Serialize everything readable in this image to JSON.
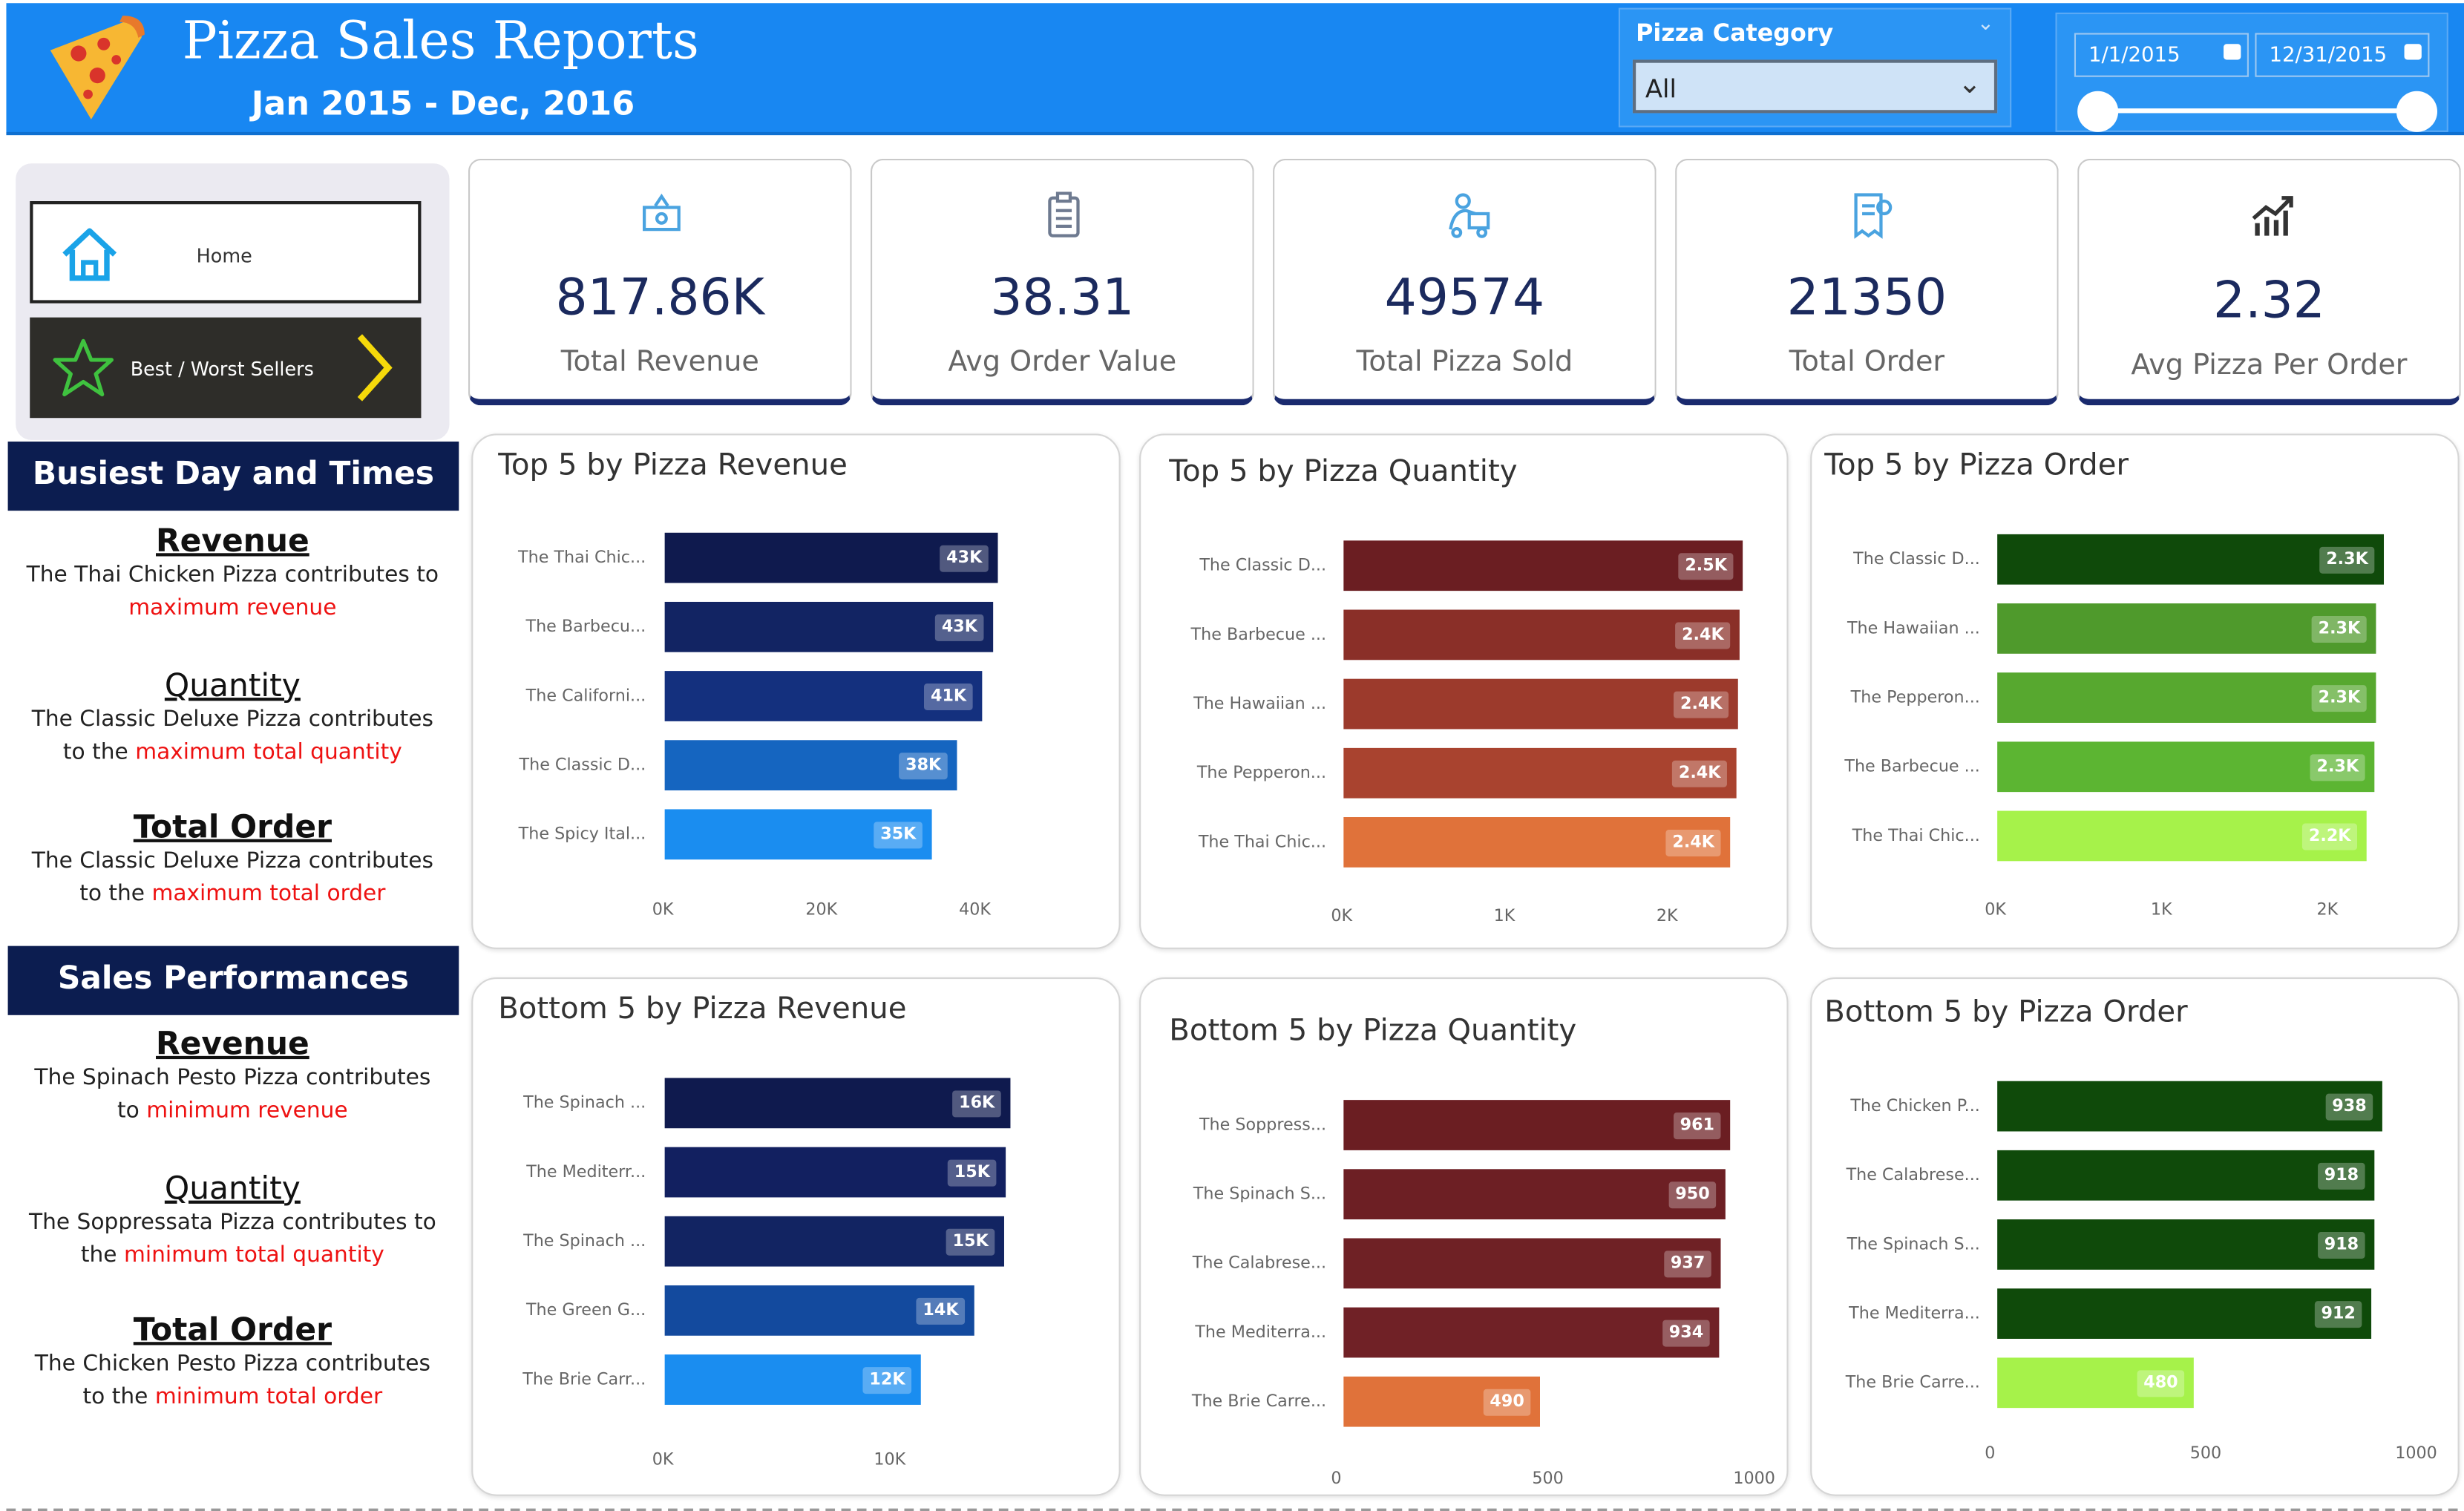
{
  "header": {
    "title": "Pizza Sales Reports",
    "subtitle": "Jan 2015 - Dec, 2016",
    "color": "#1887f2"
  },
  "filters": {
    "category_label": "Pizza Category",
    "category_value": "All",
    "date_start": "1/1/2015",
    "date_end": "12/31/2015"
  },
  "nav": {
    "home_label": "Home",
    "best_worst_label": "Best / Worst Sellers"
  },
  "busiest": {
    "header": "Busiest Day and Times",
    "items": [
      {
        "title": "Revenue",
        "text": "The Thai Chicken Pizza contributes to",
        "highlight": "maximum revenue",
        "tail": ""
      },
      {
        "title": "Quantity",
        "text": "The Classic Deluxe Pizza contributes",
        "text2": "to the ",
        "highlight": "maximum total quantity"
      },
      {
        "title": "Total Order",
        "text": "The Classic Deluxe Pizza contributes",
        "text2": "to the ",
        "highlight": "maximum total order"
      }
    ]
  },
  "sales": {
    "header": "Sales Performances",
    "items": [
      {
        "title": "Revenue",
        "text": "The Spinach Pesto Pizza contributes",
        "text2": "to ",
        "highlight": "minimum revenue"
      },
      {
        "title": "Quantity",
        "text": "The Soppressata Pizza contributes to",
        "text2": "the ",
        "highlight": "minimum total quantity"
      },
      {
        "title": "Total Order",
        "text": "The Chicken Pesto Pizza contributes",
        "text2": "to the ",
        "highlight": "minimum total order"
      }
    ]
  },
  "kpis": [
    {
      "value": "817.86K",
      "label": "Total Revenue",
      "icon": "money-icon"
    },
    {
      "value": "38.31",
      "label": "Avg Order Value",
      "icon": "clipboard-icon"
    },
    {
      "value": "49574",
      "label": "Total Pizza Sold",
      "icon": "delivery-icon"
    },
    {
      "value": "21350",
      "label": "Total Order",
      "icon": "receipt-icon"
    },
    {
      "value": "2.32",
      "label": "Avg Pizza Per Order",
      "icon": "growth-chart-icon"
    }
  ],
  "chart_data": [
    {
      "type": "bar",
      "title": "Top 5 by Pizza Revenue",
      "categories": [
        "The Thai Chic...",
        "The Barbecu...",
        "The Californi...",
        "The Classic D...",
        "The Spicy Ital..."
      ],
      "values": [
        43434,
        42768,
        41410,
        38180,
        34831
      ],
      "data_labels": [
        "43K",
        "43K",
        "41K",
        "38K",
        "35K"
      ],
      "xlim": [
        0,
        43434
      ],
      "ticks": [
        "0K",
        "20K",
        "40K"
      ],
      "tick_values": [
        0,
        20000,
        40000
      ],
      "colors": [
        "#0f1a4e",
        "#122463",
        "#14307e",
        "#1565c0",
        "#1a8df0"
      ]
    },
    {
      "type": "bar",
      "title": "Top 5 by Pizza Quantity",
      "categories": [
        "The Classic D...",
        "The Barbecue ...",
        "The Hawaiian ...",
        "The Pepperon...",
        "The Thai Chic..."
      ],
      "values": [
        2453,
        2432,
        2422,
        2418,
        2371
      ],
      "data_labels": [
        "2.5K",
        "2.4K",
        "2.4K",
        "2.4K",
        "2.4K"
      ],
      "xlim": [
        0,
        2453
      ],
      "ticks": [
        "0K",
        "1K",
        "2K"
      ],
      "tick_values": [
        0,
        1000,
        2000
      ],
      "colors": [
        "#6b1e22",
        "#8a2f28",
        "#9c3a2c",
        "#a9432f",
        "#e0723a"
      ]
    },
    {
      "type": "bar",
      "title": "Top 5 by Pizza Order",
      "categories": [
        "The Classic D...",
        "The Hawaiian ...",
        "The Pepperon...",
        "The Barbecue ...",
        "The Thai Chic..."
      ],
      "values": [
        2329,
        2280,
        2278,
        2273,
        2225
      ],
      "data_labels": [
        "2.3K",
        "2.3K",
        "2.3K",
        "2.3K",
        "2.2K"
      ],
      "xlim": [
        0,
        2329
      ],
      "ticks": [
        "0K",
        "1K",
        "2K"
      ],
      "tick_values": [
        0,
        1000,
        2000
      ],
      "colors": [
        "#0f4a0a",
        "#4f9a2c",
        "#57a82f",
        "#5cb532",
        "#a6f24a"
      ]
    },
    {
      "type": "bar",
      "title": "Bottom 5 by Pizza Revenue",
      "categories": [
        "The Spinach ...",
        "The Mediterr...",
        "The Spinach ...",
        "The Green G...",
        "The Brie Carr..."
      ],
      "values": [
        15596,
        15360,
        15277,
        13956,
        11588
      ],
      "data_labels": [
        "16K",
        "15K",
        "15K",
        "14K",
        "12K"
      ],
      "xlim": [
        0,
        15596
      ],
      "ticks": [
        "0K",
        "10K"
      ],
      "tick_values": [
        0,
        10000
      ],
      "colors": [
        "#0f1a4e",
        "#122060",
        "#122462",
        "#134a9e",
        "#1a8df0"
      ]
    },
    {
      "type": "bar",
      "title": "Bottom 5 by Pizza Quantity",
      "categories": [
        "The Soppress...",
        "The Spinach S...",
        "The Calabrese...",
        "The Mediterra...",
        "The Brie Carre..."
      ],
      "values": [
        961,
        950,
        937,
        934,
        490
      ],
      "data_labels": [
        "961",
        "950",
        "937",
        "934",
        "490"
      ],
      "xlim": [
        0,
        961
      ],
      "ticks": [
        "0",
        "500",
        "1000"
      ],
      "tick_values": [
        0,
        500,
        1000
      ],
      "colors": [
        "#6b1e22",
        "#6d1f24",
        "#6f2125",
        "#702126",
        "#e0723a"
      ]
    },
    {
      "type": "bar",
      "title": "Bottom 5 by Pizza Order",
      "categories": [
        "The Chicken P...",
        "The Calabrese...",
        "The Spinach S...",
        "The Mediterra...",
        "The Brie Carre..."
      ],
      "values": [
        938,
        918,
        918,
        912,
        480
      ],
      "data_labels": [
        "938",
        "918",
        "918",
        "912",
        "480"
      ],
      "xlim": [
        0,
        938
      ],
      "ticks": [
        "0",
        "500",
        "1000"
      ],
      "tick_values": [
        0,
        500,
        1000
      ],
      "colors": [
        "#0f4a0a",
        "#0f4a0a",
        "#0f4a0a",
        "#0f4a0a",
        "#a6f24a"
      ]
    }
  ]
}
